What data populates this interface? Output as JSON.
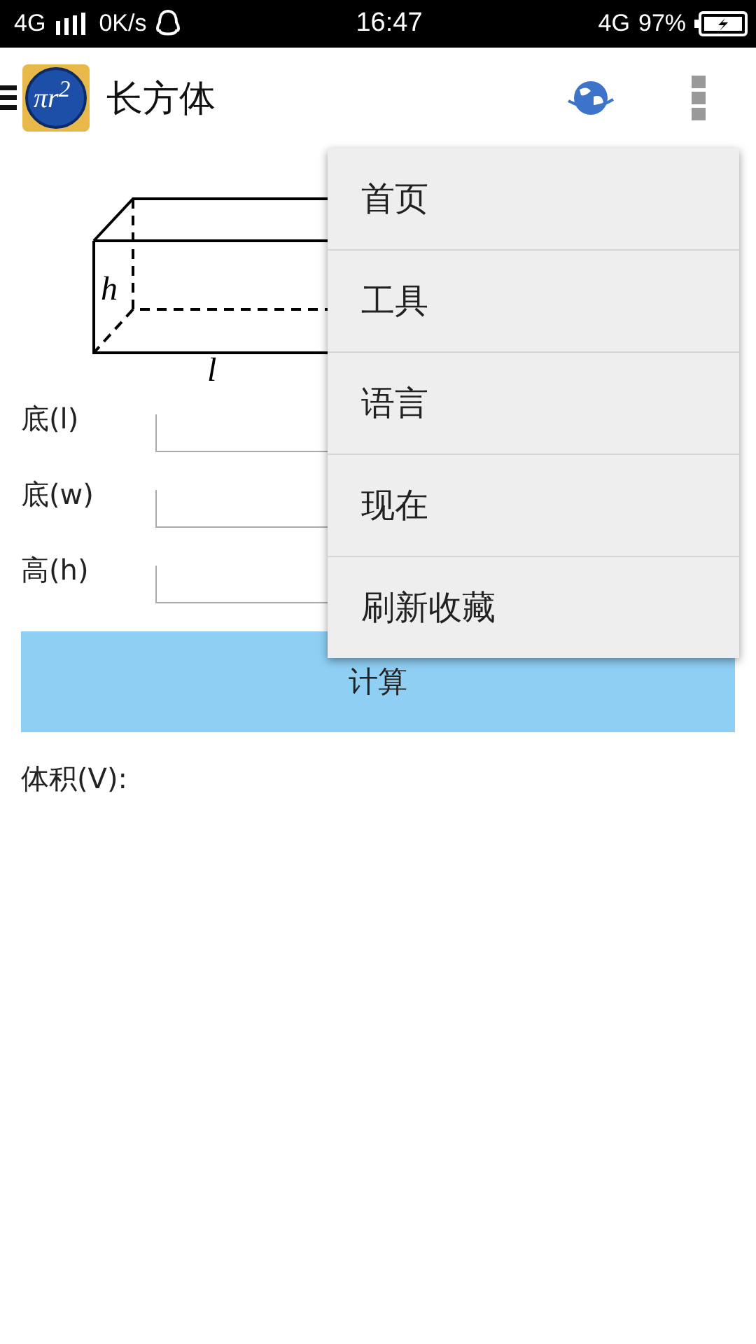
{
  "status_bar": {
    "network": "4G",
    "speed": "0K/s",
    "time": "16:47",
    "network_right": "4G",
    "battery": "97%"
  },
  "app_bar": {
    "title": "长方体",
    "logo_text": "πr$^{2}$"
  },
  "diagram": {
    "height_label": "h",
    "length_label": "l"
  },
  "fields": [
    {
      "label": "底(l)"
    },
    {
      "label": "底(w)"
    },
    {
      "label": "高(h)"
    }
  ],
  "calculate_button": "计算",
  "result_label": "体积(V):",
  "menu": [
    {
      "label": "首页"
    },
    {
      "label": "工具"
    },
    {
      "label": "语言"
    },
    {
      "label": "现在"
    },
    {
      "label": "刷新收藏"
    }
  ]
}
